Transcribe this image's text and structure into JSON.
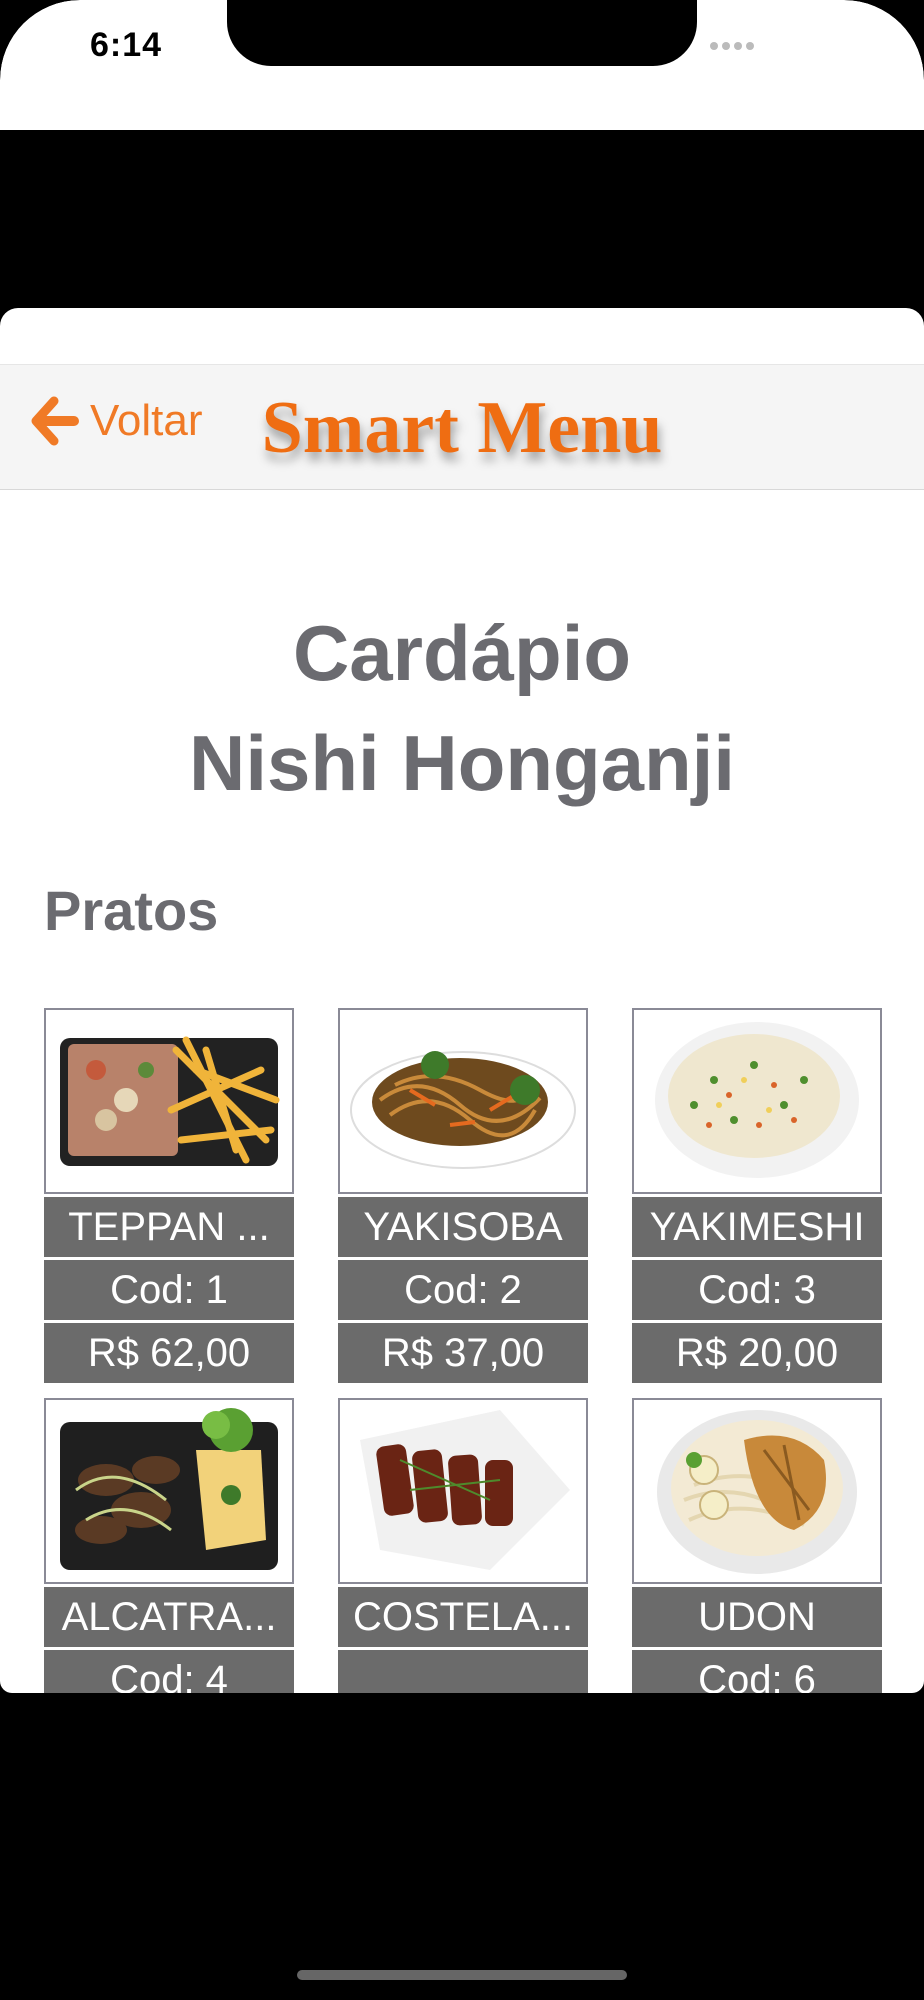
{
  "status_bar": {
    "time": "6:14"
  },
  "nav": {
    "back_label": "Voltar",
    "brand": "Smart Menu"
  },
  "header": {
    "line1": "Cardápio",
    "line2": "Nishi Honganji"
  },
  "section_title": "Pratos",
  "dishes": [
    {
      "name": "TEPPAN ...",
      "code_label": "Cod:  1",
      "price": "R$  62,00",
      "icon": "teppan-dish-photo"
    },
    {
      "name": "YAKISOBA",
      "code_label": "Cod:  2",
      "price": "R$  37,00",
      "icon": "yakisoba-dish-photo"
    },
    {
      "name": "YAKIMESHI",
      "code_label": "Cod:  3",
      "price": "R$  20,00",
      "icon": "yakimeshi-dish-photo"
    },
    {
      "name": "ALCATRA...",
      "code_label": "Cod:  4",
      "price": "",
      "icon": "alcatra-dish-photo"
    },
    {
      "name": "COSTELA...",
      "code_label": "",
      "price": "",
      "icon": "costela-dish-photo"
    },
    {
      "name": "UDON",
      "code_label": "Cod:  6",
      "price": "",
      "icon": "udon-dish-photo"
    }
  ],
  "colors": {
    "accent": "#ef6d12",
    "text_gray": "#6b6b70",
    "label_bg": "#6b6b6b"
  }
}
